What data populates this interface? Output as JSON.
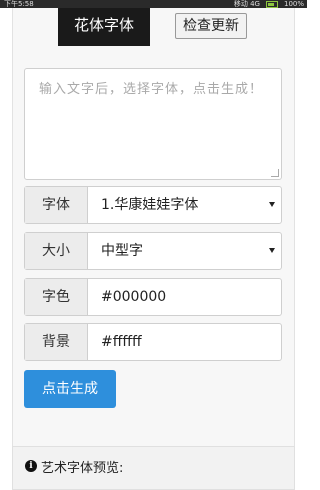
{
  "status": {
    "time": "下午5:58",
    "carrier": "移动 4G",
    "battery": "100%"
  },
  "header": {
    "active_tab": "花体字体",
    "update_button": "检查更新"
  },
  "text_input": {
    "placeholder": "输入文字后，选择字体，点击生成！"
  },
  "fields": [
    {
      "label": "字体",
      "value": "1.华康娃娃字体"
    },
    {
      "label": "大小",
      "value": "中型字"
    },
    {
      "label": "字色",
      "value": "#000000"
    },
    {
      "label": "背景",
      "value": "#ffffff"
    }
  ],
  "generate_button": "点击生成",
  "preview": {
    "title": "艺术字体预览:"
  },
  "colors": {
    "accent": "#2e8fdc",
    "tab_bg": "#1a1a1a"
  }
}
